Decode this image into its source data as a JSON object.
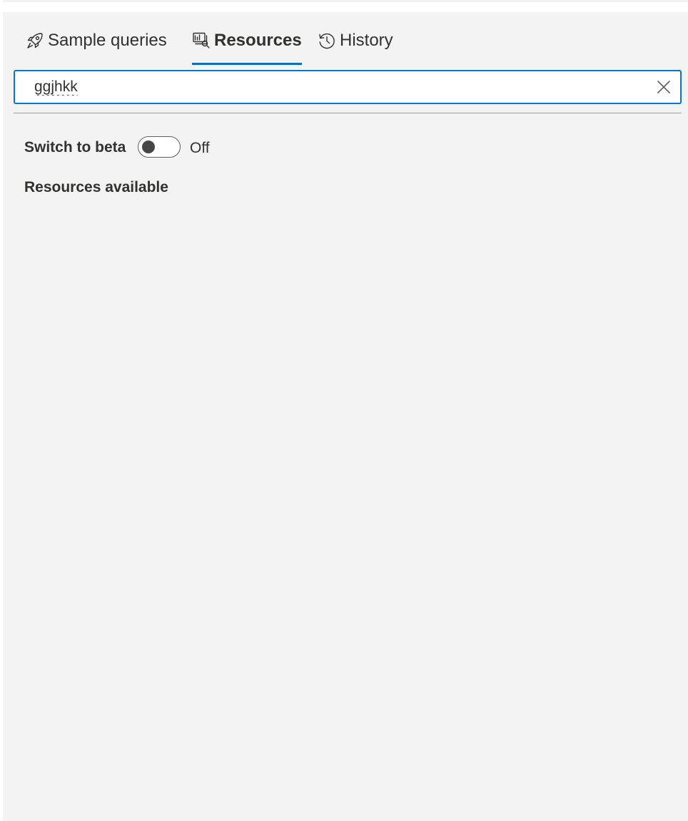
{
  "tabs": [
    {
      "label": "Sample queries",
      "icon": "rocket-icon",
      "active": false
    },
    {
      "label": "Resources",
      "icon": "resources-icon",
      "active": true
    },
    {
      "label": "History",
      "icon": "history-icon",
      "active": false
    }
  ],
  "search": {
    "value": "ggjhkk",
    "clear_icon": "close-icon"
  },
  "beta": {
    "label": "Switch to beta",
    "state": "Off",
    "on": false
  },
  "resources": {
    "heading": "Resources available",
    "items": []
  },
  "colors": {
    "accent": "#0078d4",
    "tab_underline": "#0f6cbd",
    "panel_background": "#f3f3f3",
    "text": "#323130",
    "spellcheck": "#e81123"
  }
}
